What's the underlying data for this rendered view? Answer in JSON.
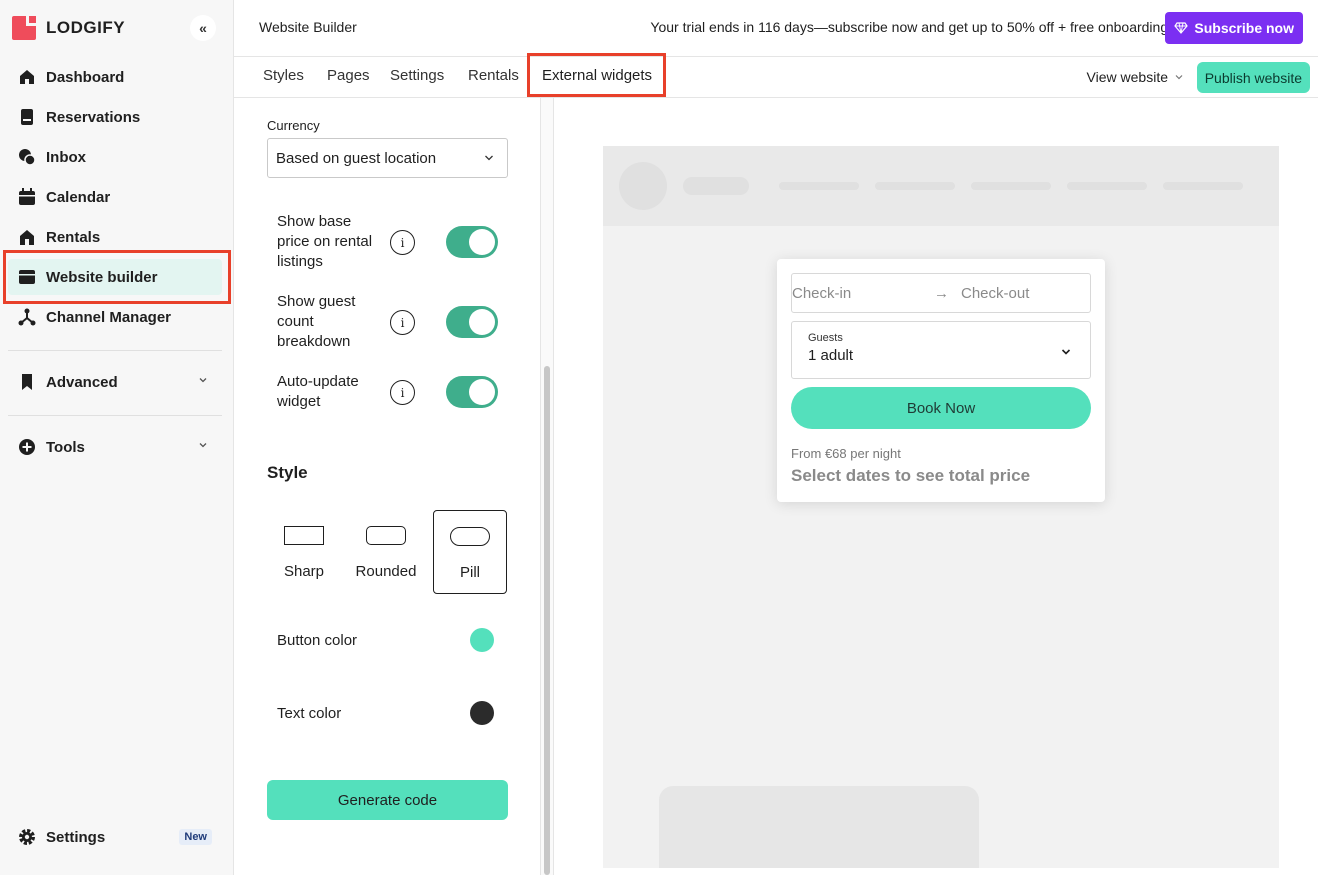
{
  "brand": {
    "name": "LODGIFY",
    "accent": "#ef4c5b"
  },
  "sidebar": {
    "collapse_icon": "double-chevron-left-icon",
    "items": [
      {
        "label": "Dashboard",
        "icon": "home-icon"
      },
      {
        "label": "Reservations",
        "icon": "book-icon"
      },
      {
        "label": "Inbox",
        "icon": "chat-icon"
      },
      {
        "label": "Calendar",
        "icon": "calendar-icon"
      },
      {
        "label": "Rentals",
        "icon": "house-icon"
      },
      {
        "label": "Website builder",
        "icon": "browser-icon",
        "active": true
      },
      {
        "label": "Channel Manager",
        "icon": "network-icon"
      }
    ],
    "advanced": {
      "label": "Advanced",
      "icon": "bookmark-icon"
    },
    "tools": {
      "label": "Tools",
      "icon": "plus-circle-icon"
    },
    "settings": {
      "label": "Settings",
      "icon": "gear-icon",
      "badge": "New"
    }
  },
  "header": {
    "title": "Website Builder",
    "trial_text": "Your trial ends in 116 days—subscribe now and get up to 50% off + free onboarding.",
    "subscribe_label": "Subscribe now",
    "subscribe_color": "#7b2ff2"
  },
  "tabs": {
    "items": [
      "Styles",
      "Pages",
      "Settings",
      "Rentals",
      "External widgets"
    ],
    "active": "External widgets",
    "view_website": "View website",
    "publish": "Publish website"
  },
  "panel": {
    "currency_label": "Currency",
    "currency_value": "Based on guest location",
    "options": [
      {
        "label": "Show base price on rental listings",
        "enabled": true
      },
      {
        "label": "Show guest count breakdown",
        "enabled": true
      },
      {
        "label": "Auto-update widget",
        "enabled": true
      }
    ],
    "style_heading": "Style",
    "styles": [
      {
        "name": "Sharp"
      },
      {
        "name": "Rounded"
      },
      {
        "name": "Pill",
        "selected": true
      }
    ],
    "button_color_label": "Button color",
    "button_color": "#54e0bc",
    "text_color_label": "Text color",
    "text_color": "#2b2b2b",
    "generate_label": "Generate code"
  },
  "widget": {
    "checkin": "Check-in",
    "checkout": "Check-out",
    "guests_label": "Guests",
    "guests_value": "1 adult",
    "book_label": "Book Now",
    "from_price": "From €68 per night",
    "select_dates": "Select dates to see total price"
  }
}
